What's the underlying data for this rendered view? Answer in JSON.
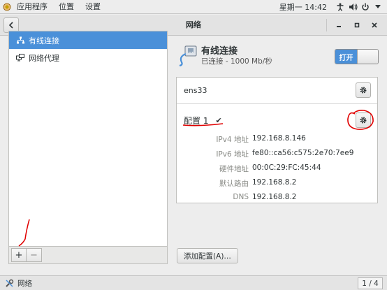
{
  "topbar": {
    "menu": [
      "应用程序",
      "位置",
      "设置"
    ],
    "clock": "星期一 14:42",
    "icons": [
      "accessibility-icon",
      "volume-icon",
      "power-icon",
      "chevron-down-icon"
    ]
  },
  "window": {
    "title": "网络"
  },
  "sidebar": {
    "items": [
      {
        "label": "有线连接",
        "icon": "wired-network-icon",
        "selected": true
      },
      {
        "label": "网络代理",
        "icon": "proxy-icon",
        "selected": false
      }
    ],
    "add_label": "+",
    "remove_label": "−"
  },
  "connection": {
    "title": "有线连接",
    "status": "已连接 - 1000 Mb/秒",
    "switch_label": "打开",
    "switch_on": true
  },
  "device": {
    "name": "ens33"
  },
  "profile": {
    "name": "配置 1",
    "check": "✔",
    "details": [
      {
        "key": "IPv4 地址",
        "value": "192.168.8.146"
      },
      {
        "key": "IPv6 地址",
        "value": "fe80::ca56:c575:2e70:7ee9"
      },
      {
        "key": "硬件地址",
        "value": "00:0C:29:FC:45:44"
      },
      {
        "key": "默认路由",
        "value": "192.168.8.2"
      },
      {
        "key": "DNS",
        "value": "192.168.8.2"
      }
    ]
  },
  "add_profile_label": "添加配置(A)…",
  "taskbar": {
    "item_label": "网络",
    "workspace": "1 / 4"
  },
  "colors": {
    "accent": "#4a90d9",
    "annotation": "#e00000"
  }
}
